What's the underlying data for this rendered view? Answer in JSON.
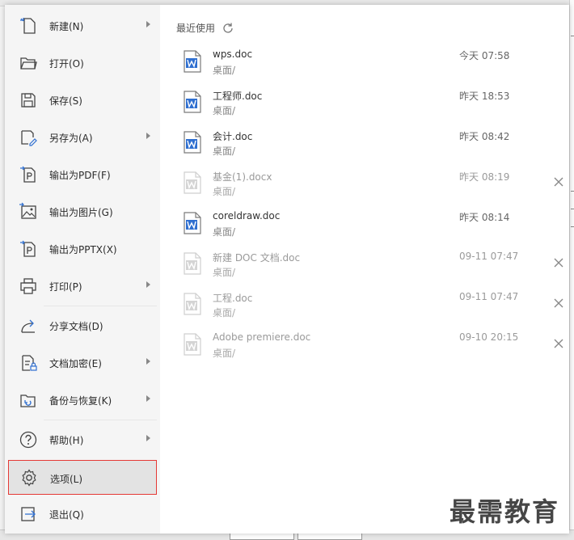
{
  "menu": {
    "items": [
      {
        "label": "新建(N)",
        "icon": "new-document-icon"
      },
      {
        "label": "打开(O)",
        "icon": "folder-open-icon"
      },
      {
        "label": "保存(S)",
        "icon": "save-icon"
      },
      {
        "label": "另存为(A)",
        "icon": "save-as-icon"
      },
      {
        "label": "输出为PDF(F)",
        "icon": "export-pdf-icon"
      },
      {
        "label": "输出为图片(G)",
        "icon": "export-image-icon"
      },
      {
        "label": "输出为PPTX(X)",
        "icon": "export-pptx-icon"
      },
      {
        "label": "打印(P)",
        "icon": "print-icon"
      },
      {
        "label": "分享文档(D)",
        "icon": "share-icon"
      },
      {
        "label": "文档加密(E)",
        "icon": "encrypt-icon"
      },
      {
        "label": "备份与恢复(K)",
        "icon": "backup-icon"
      },
      {
        "label": "帮助(H)",
        "icon": "help-icon"
      },
      {
        "label": "选项(L)",
        "icon": "gear-icon"
      },
      {
        "label": "退出(Q)",
        "icon": "exit-icon"
      }
    ]
  },
  "recent": {
    "header": "最近使用",
    "files": [
      {
        "name": "wps.doc",
        "path": "桌面/",
        "time": "今天 07:58",
        "available": true
      },
      {
        "name": "工程师.doc",
        "path": "桌面/",
        "time": "昨天 18:53",
        "available": true
      },
      {
        "name": "会计.doc",
        "path": "桌面/",
        "time": "昨天 08:42",
        "available": true
      },
      {
        "name": "基金(1).docx",
        "path": "桌面/",
        "time": "昨天 08:19",
        "available": false
      },
      {
        "name": "coreldraw.doc",
        "path": "桌面/",
        "time": "昨天 08:14",
        "available": true
      },
      {
        "name": "新建 DOC 文档.doc",
        "path": "桌面/",
        "time": "09-11 07:47",
        "available": false
      },
      {
        "name": "工程.doc",
        "path": "桌面/",
        "time": "09-11 07:47",
        "available": false
      },
      {
        "name": "Adobe premiere.doc",
        "path": "桌面/",
        "time": "09-10 20:15",
        "available": false
      }
    ]
  },
  "watermark": "最需教育",
  "colors": {
    "accent_blue": "#2f6fd0",
    "selected_border": "#e53935",
    "disabled_gray": "#c8c8c8"
  }
}
